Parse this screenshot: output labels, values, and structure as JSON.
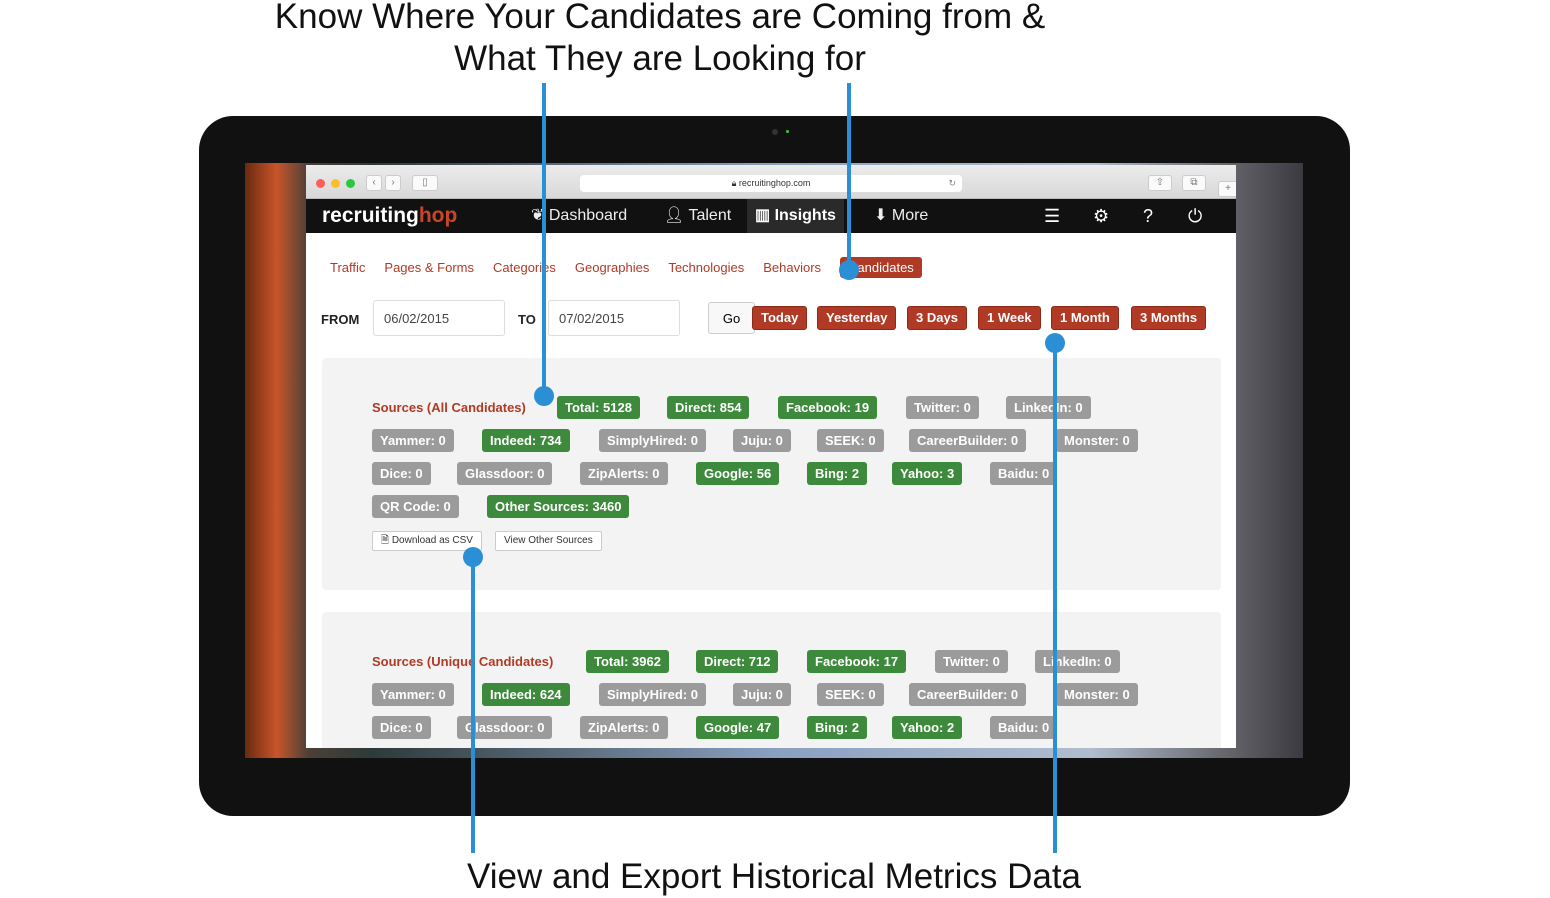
{
  "headline_top": [
    "Know Where Your Candidates are Coming from &",
    "What They are Looking for"
  ],
  "headline_bottom": "View and Export Historical Metrics Data",
  "browser": {
    "url": "recruitinghop.com"
  },
  "logo": {
    "main": "recruiting",
    "accent": "hop"
  },
  "nav": {
    "items": [
      {
        "label": "Dashboard",
        "icon": "leaf-icon"
      },
      {
        "label": "Talent",
        "icon": "user-icon"
      },
      {
        "label": "Insights",
        "icon": "bar-chart-icon",
        "active": true
      },
      {
        "label": "More",
        "icon": "download-circle-icon"
      }
    ],
    "icons": [
      "list-icon",
      "gears-icon",
      "help-icon",
      "power-icon"
    ]
  },
  "subnav": [
    "Traffic",
    "Pages & Forms",
    "Categories",
    "Geographies",
    "Technologies",
    "Behaviors",
    "Candidates"
  ],
  "subnav_active": "Candidates",
  "range": {
    "from_label": "FROM",
    "from": "06/02/2015",
    "to_label": "TO",
    "to": "07/02/2015",
    "go": "Go",
    "presets": [
      "Today",
      "Yesterday",
      "3 Days",
      "1 Week",
      "1 Month",
      "3 Months"
    ]
  },
  "panel_all": {
    "title": "Sources (All Candidates)",
    "badges": [
      "Total: 5128",
      "Direct: 854",
      "Facebook: 19",
      "Twitter: 0",
      "LinkedIn: 0",
      "Yammer: 0",
      "Indeed: 734",
      "SimplyHired: 0",
      "Juju: 0",
      "SEEK: 0",
      "CareerBuilder: 0",
      "Monster: 0",
      "Dice: 0",
      "Glassdoor: 0",
      "ZipAlerts: 0",
      "Google: 56",
      "Bing: 2",
      "Yahoo: 3",
      "Baidu: 0",
      "QR Code: 0",
      "Other Sources: 3460"
    ],
    "download": "Download as CSV",
    "view_other": "View Other Sources"
  },
  "panel_unique": {
    "title": "Sources (Unique Candidates)",
    "badges": [
      "Total: 3962",
      "Direct: 712",
      "Facebook: 17",
      "Twitter: 0",
      "LinkedIn: 0",
      "Yammer: 0",
      "Indeed: 624",
      "SimplyHired: 0",
      "Juju: 0",
      "SEEK: 0",
      "CareerBuilder: 0",
      "Monster: 0",
      "Dice: 0",
      "Glassdoor: 0",
      "ZipAlerts: 0",
      "Google: 47",
      "Bing: 2",
      "Yahoo: 2",
      "Baidu: 0"
    ]
  },
  "colors": {
    "accent": "#b03a25",
    "green": "#3d8a3d",
    "gray": "#9b9b9b",
    "callout": "#2b8fd6"
  }
}
